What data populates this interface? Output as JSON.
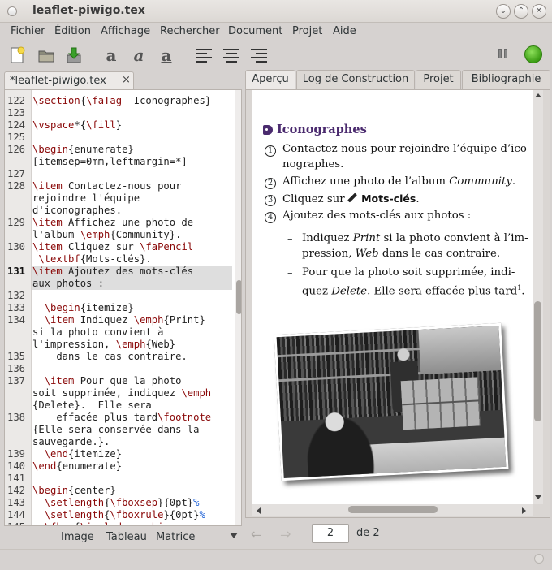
{
  "window": {
    "title": "leaflet-piwigo.tex"
  },
  "menu": [
    "Fichier",
    "Édition",
    "Affichage",
    "Rechercher",
    "Document",
    "Projet",
    "Aide"
  ],
  "editor": {
    "tab_label": "*leaflet-piwigo.tex",
    "tab_close": "×",
    "line_numbers": [
      "122",
      "123",
      "124",
      "125",
      "126",
      "",
      "127",
      "128",
      "",
      "",
      "129",
      "",
      "130",
      "",
      "131",
      "",
      "132",
      "133",
      "134",
      "",
      "",
      "135",
      "136",
      "137",
      "",
      "",
      "138",
      "",
      "",
      "139",
      "140",
      "141",
      "142",
      "143",
      "144",
      "145"
    ],
    "current_line": "131",
    "bottom_tabs": [
      "Image",
      "Tableau",
      "Matrice"
    ]
  },
  "preview": {
    "tabs": [
      "Aperçu",
      "Log de Construction",
      "Projet",
      "Bibliographie"
    ],
    "active_tab": "Aperçu",
    "heading": "Iconographes",
    "items": [
      {
        "num": "1",
        "line1": "Contactez-nous pour rejoindre l’équipe d’ico-",
        "line2": "nographes."
      },
      {
        "num": "2",
        "pre": "Affichez une photo de l’album ",
        "em": "Community",
        "post": "."
      },
      {
        "num": "3",
        "pre": "Cliquez sur ",
        "strong": "Mots-clés",
        "post": "."
      },
      {
        "num": "4",
        "text": "Ajoutez des mots-clés aux photos :"
      }
    ],
    "subitems": [
      {
        "l1_pre": "Indiquez ",
        "l1_em": "Print",
        "l1_post": " si la photo convient à l’im-",
        "l2_pre": "pression, ",
        "l2_em": "Web",
        "l2_post": " dans le cas contraire."
      },
      {
        "l1": "Pour que la photo soit supprimée, indi-",
        "l2_pre": "quez ",
        "l2_em": "Delete",
        "l2_post": ". Elle sera effacée plus tard",
        "sup": "1",
        "l2_end": "."
      }
    ],
    "dash": "–",
    "page_current": "2",
    "page_of": "de 2",
    "nav_left": "⇐",
    "nav_right": "⇒"
  },
  "colors": {
    "heading": "#4a2a6e",
    "command": "#8a0808",
    "run": "#3c9d14"
  }
}
